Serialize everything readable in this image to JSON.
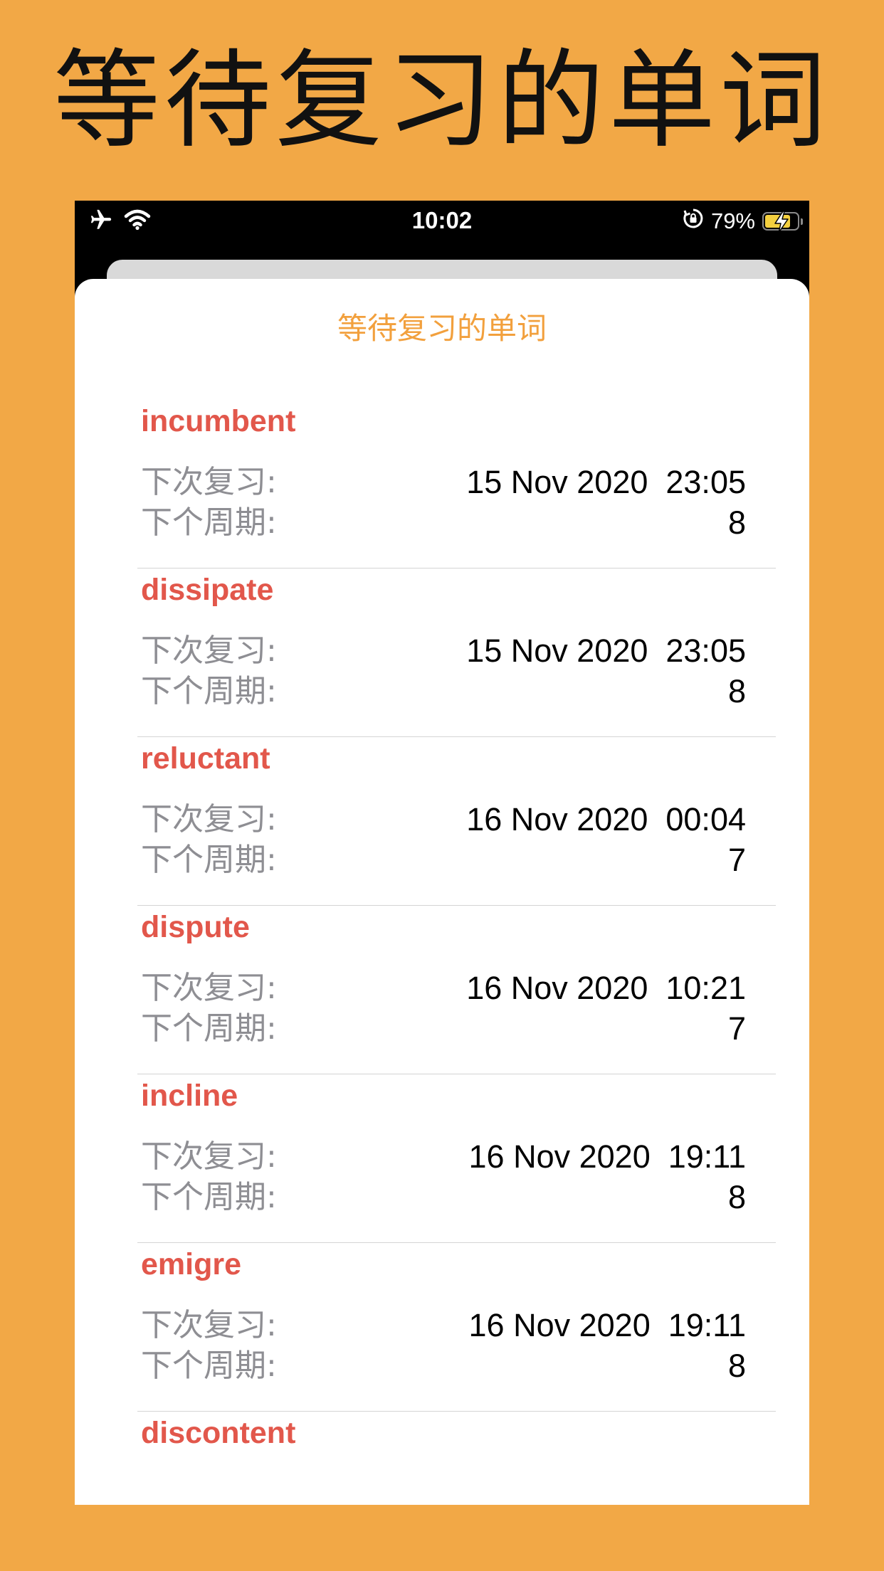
{
  "banner": {
    "title": "等待复习的单词"
  },
  "status_bar": {
    "time": "10:02",
    "battery_text": "79%",
    "battery_level": 0.79,
    "icons": [
      "airplane-icon",
      "wifi-icon",
      "orientation-lock-icon",
      "battery-charging-icon"
    ]
  },
  "sheet": {
    "title": "等待复习的单词"
  },
  "labels": {
    "next_review": "下次复习:",
    "next_cycle": "下个周期:"
  },
  "words": [
    {
      "word": "incumbent",
      "next_review": "15 Nov 2020  23:05",
      "next_cycle": "8"
    },
    {
      "word": "dissipate",
      "next_review": "15 Nov 2020  23:05",
      "next_cycle": "8"
    },
    {
      "word": "reluctant",
      "next_review": "16 Nov 2020  00:04",
      "next_cycle": "7"
    },
    {
      "word": "dispute",
      "next_review": "16 Nov 2020  10:21",
      "next_cycle": "7"
    },
    {
      "word": "incline",
      "next_review": "16 Nov 2020  19:11",
      "next_cycle": "8"
    },
    {
      "word": "emigre",
      "next_review": "16 Nov 2020  19:11",
      "next_cycle": "8"
    },
    {
      "word": "discontent"
    }
  ],
  "colors": {
    "background": "#F2A846",
    "accent_title": "#F2A03D",
    "word": "#E2574B",
    "label": "#8E8E93",
    "value": "#000000"
  }
}
